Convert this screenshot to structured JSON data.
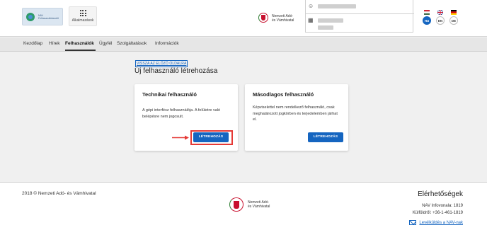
{
  "header": {
    "logo_text": "NAV Felhasználókezelő",
    "apps_label": "Alkalmazások",
    "brand_name_line1": "Nemzeti Adó-",
    "brand_name_line2": "és Vámhivatal",
    "languages": [
      {
        "code": "HU",
        "active": true
      },
      {
        "code": "EN",
        "active": false
      },
      {
        "code": "DE",
        "active": false
      }
    ],
    "icons": {
      "user": "person-icon",
      "company": "building-icon",
      "apps": "grid-icon"
    }
  },
  "nav": {
    "items": [
      "Kezdőlap",
      "Hírek",
      "Felhasználók",
      "Ügyfél",
      "Szolgáltatások",
      "Információk"
    ],
    "active": "Felhasználók"
  },
  "main": {
    "back_link": "VISSZA AZ ELŐZŐ OLDALRA",
    "title": "Új felhasználó létrehozása",
    "cards": [
      {
        "title": "Technikai felhasználó",
        "description": "A gépi interfész felhasználója. A felületre való belépésre nem jogosult.",
        "button": "LÉTREHOZÁS"
      },
      {
        "title": "Másodlagos felhasználó",
        "description": "Képviselettel nem rendelkező felhasználó, csak meghatározott jogkörben és terjedelemben járhat el.",
        "button": "LÉTREHOZÁS"
      }
    ]
  },
  "footer": {
    "copyright": "2018 © Nemzeti Adó- és Vámhivatal",
    "brand_name_line1": "Nemzeti Adó-",
    "brand_name_line2": "és Vámhivatal",
    "contact_title": "Elérhetőségek",
    "infoline": "NAV Infovonala: 1819",
    "abroad": "Külföldről: +36-1-461-1819",
    "mail_link": "Levélküldés a NAV-nak"
  },
  "colors": {
    "accent": "#1565c0",
    "highlight": "#e53935"
  }
}
